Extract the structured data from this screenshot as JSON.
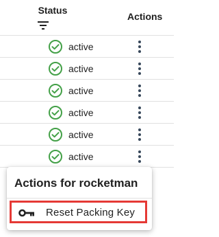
{
  "table": {
    "headers": {
      "status": "Status",
      "actions": "Actions"
    },
    "rows": [
      {
        "status": "active"
      },
      {
        "status": "active"
      },
      {
        "status": "active"
      },
      {
        "status": "active"
      },
      {
        "status": "active"
      },
      {
        "status": "active"
      }
    ]
  },
  "menu": {
    "title": "Actions for rocketman",
    "items": [
      {
        "label": "Reset Packing Key",
        "icon": "key-icon"
      }
    ]
  },
  "colors": {
    "status_ok": "#43a047",
    "highlight": "#e53935",
    "kebab": "#37475a"
  }
}
